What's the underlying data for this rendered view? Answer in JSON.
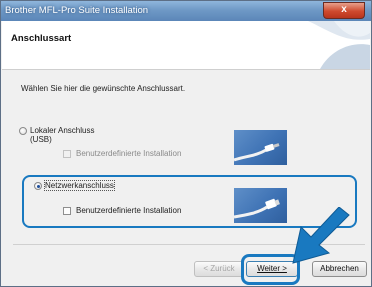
{
  "window": {
    "title": "Brother MFL-Pro Suite Installation",
    "close_label": "x"
  },
  "header": {
    "title": "Anschlussart"
  },
  "content": {
    "instruction": "Wählen Sie hier die gewünschte Anschlussart."
  },
  "options": [
    {
      "label": "Lokaler Anschluss",
      "sublabel": "(USB)",
      "selected": false,
      "checkbox_label": "Benutzerdefinierte Installation",
      "checkbox_enabled": false
    },
    {
      "label": "Netzwerkanschluss",
      "selected": true,
      "checkbox_label": "Benutzerdefinierte Installation",
      "checkbox_enabled": true
    }
  ],
  "buttons": {
    "back": "< Zurück",
    "next": "Weiter >",
    "cancel": "Abbrechen"
  },
  "colors": {
    "accent": "#1979c0",
    "titlebar": "#6f99c6",
    "close": "#cf4a2e"
  }
}
